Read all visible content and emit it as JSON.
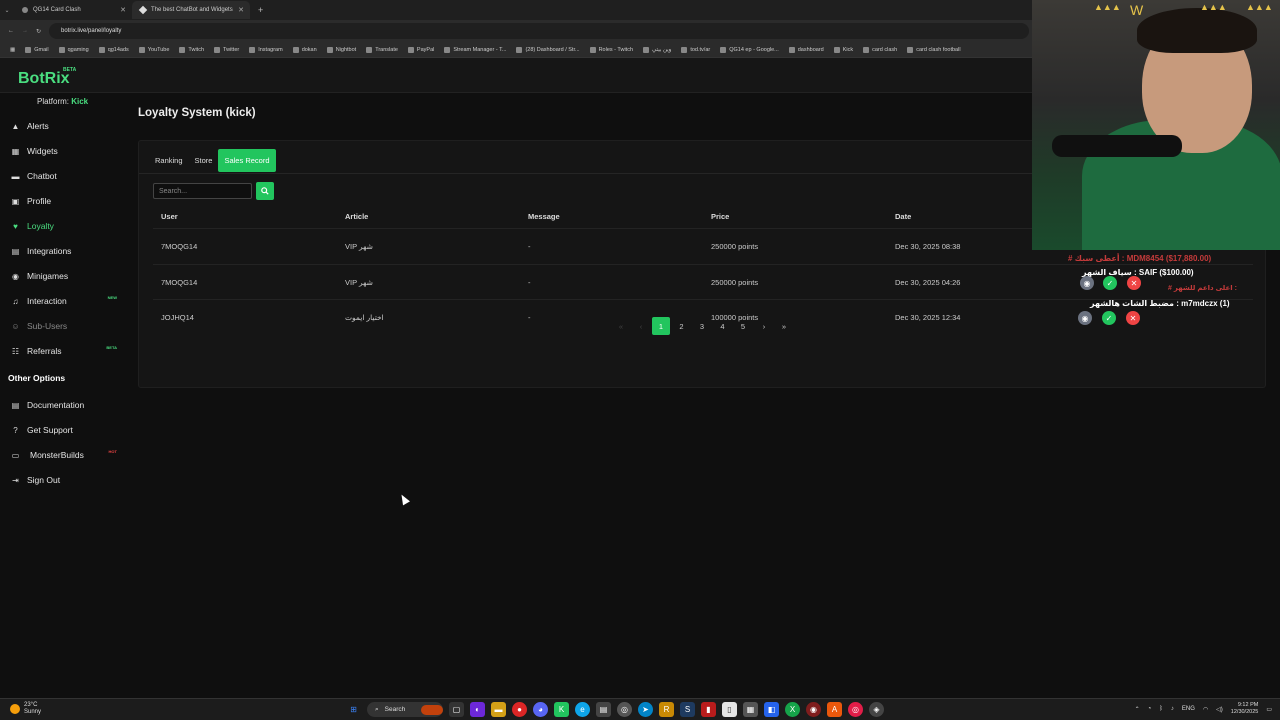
{
  "browser": {
    "tabs": [
      {
        "label": "QG14 Card Clash",
        "active": false
      },
      {
        "label": "The best ChatBot and Widgets",
        "active": true
      }
    ],
    "url": "botrix.live/panel/loyalty",
    "bookmarks": [
      "Gmail",
      "qgaming",
      "qg14ads",
      "YouTube",
      "Twitch",
      "Twitter",
      "Instagram",
      "dokan",
      "Nightbot",
      "Translate",
      "PayPal",
      "Stream Manager - T...",
      "(28) Dashboard / Str...",
      "Roles - Twitch",
      "وين بيتي",
      "tod.tv/ar",
      "QG14 ep - Google...",
      "dashboard",
      "Kick",
      "card clash",
      "card clash football"
    ]
  },
  "app": {
    "logo": "BotRix",
    "logo_badge": "BETA",
    "platform_label": "Platform: ",
    "platform_value": "Kick"
  },
  "sidebar": {
    "items": [
      {
        "label": "Alerts",
        "icon": "warning-icon"
      },
      {
        "label": "Widgets",
        "icon": "widgets-icon"
      },
      {
        "label": "Chatbot",
        "icon": "chat-icon"
      },
      {
        "label": "Profile",
        "icon": "profile-icon"
      },
      {
        "label": "Loyalty",
        "icon": "heart-icon",
        "active": true
      },
      {
        "label": "Integrations",
        "icon": "integrations-icon"
      },
      {
        "label": "Minigames",
        "icon": "gamepad-icon"
      },
      {
        "label": "Interaction",
        "icon": "music-icon",
        "badge": "NEW"
      },
      {
        "label": "Sub-Users",
        "icon": "users-icon",
        "muted": true
      },
      {
        "label": "Referrals",
        "icon": "referrals-icon",
        "badge": "BETA"
      }
    ],
    "other_title": "Other Options",
    "other_items": [
      {
        "label": "Documentation",
        "icon": "book-icon"
      },
      {
        "label": "Get Support",
        "icon": "help-icon"
      },
      {
        "label": "MonsterBuilds",
        "icon": "laptop-icon",
        "badge": "HOT"
      },
      {
        "label": "Sign Out",
        "icon": "signout-icon"
      }
    ]
  },
  "main": {
    "title": "Loyalty System (kick)",
    "tabs": [
      "Ranking",
      "Store",
      "Sales Record"
    ],
    "active_tab": "Sales Record",
    "search_placeholder": "Search...",
    "columns": [
      "User",
      "Article",
      "Message",
      "Price",
      "Date"
    ],
    "rows": [
      {
        "user": "7MOQG14",
        "article": "VIP شهر",
        "message": "-",
        "price": "250000 points",
        "date": "Dec 30, 2025 08:38"
      },
      {
        "user": "7MOQG14",
        "article": "VIP شهر",
        "message": "-",
        "price": "250000 points",
        "date": "Dec 30, 2025 04:26"
      },
      {
        "user": "JOJHQ14",
        "article": "اختيار ايموت",
        "message": "-",
        "price": "100000 points",
        "date": "Dec 30, 2025 12:34"
      }
    ],
    "pagination": {
      "first": "«",
      "prev": "‹",
      "pages": [
        "1",
        "2",
        "3",
        "4",
        "5"
      ],
      "current": "1",
      "next": "›",
      "last": "»"
    }
  },
  "overlay": {
    "lines": [
      {
        "text": "# أعطى سبك : MDM8454 ($17,880.00)",
        "style": "red"
      },
      {
        "text": "سياف الشهر : SAIF ($100.00)",
        "style": "white"
      },
      {
        "text": "# اعلى داعم للشهر :",
        "style": "red"
      },
      {
        "text": "مضبط الشات هالشهر : m7mdczx (1)",
        "style": "white"
      }
    ]
  },
  "taskbar": {
    "temp": "23°C",
    "weather": "Sunny",
    "search_label": "Search",
    "lang": "ENG",
    "time": "9:12 PM",
    "date": "12/30/2025"
  },
  "colors": {
    "accent": "#22c55e",
    "brand": "#4ade80",
    "bg": "#0f0f0f"
  }
}
